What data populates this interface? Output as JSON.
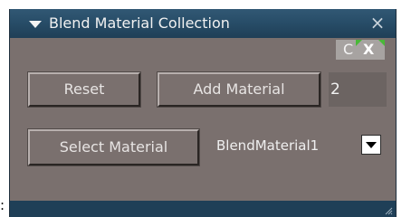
{
  "left_glyph": ":",
  "window": {
    "title": "Blend Material Collection",
    "close_symbol": "×",
    "collapse_icon": "triangle-down-icon",
    "close_icon": "close-icon"
  },
  "corner_controls": {
    "c_label": "C",
    "x_label": "X",
    "marker_color": "#49b838"
  },
  "controls": {
    "reset_label": "Reset",
    "add_material_label": "Add Material",
    "material_count": "2",
    "select_material_label": "Select Material",
    "selected_material": "BlendMaterial1",
    "dropdown_icon": "chevron-down-icon"
  },
  "colors": {
    "panel_background": "#7a706e",
    "titlebar": "#274c67",
    "text": "#efefef"
  }
}
